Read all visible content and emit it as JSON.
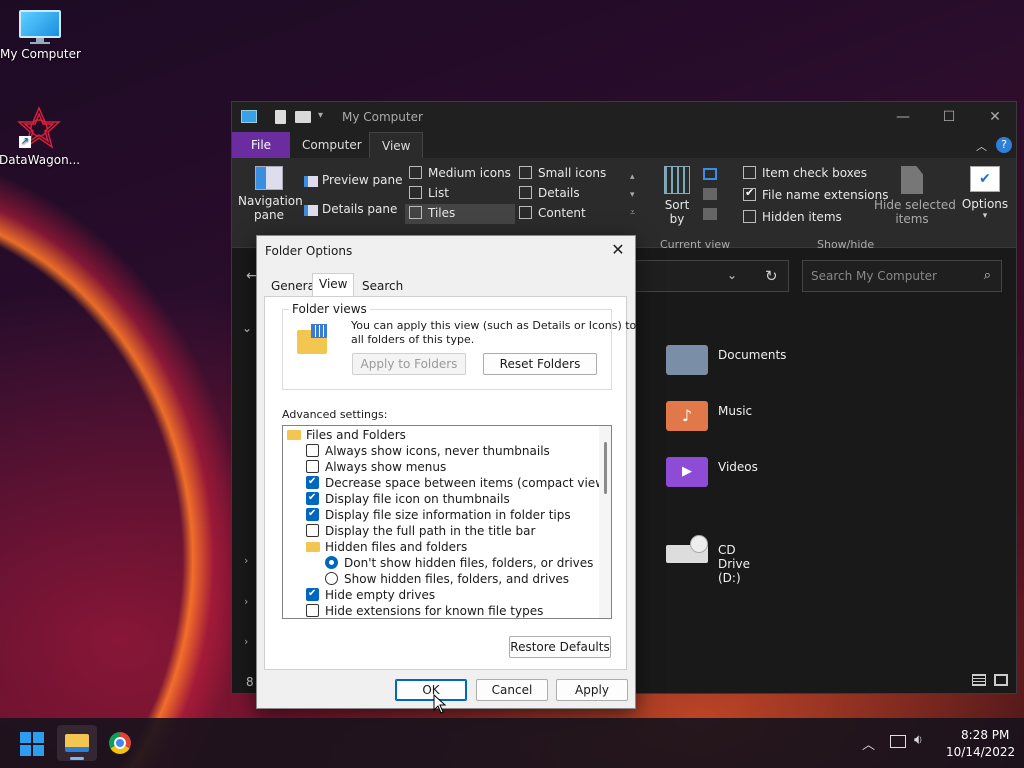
{
  "desktop": {
    "icons": [
      {
        "label": "My Computer"
      },
      {
        "label": "DataWagon..."
      }
    ]
  },
  "explorer": {
    "title": "My Computer",
    "tabs": {
      "file": "File",
      "computer": "Computer",
      "view": "View"
    },
    "ribbon": {
      "navigation_pane": "Navigation pane",
      "navigation_pane_l1": "Navigation",
      "navigation_pane_l2": "pane",
      "preview_pane": "Preview pane",
      "details_pane": "Details pane",
      "layouts": [
        "Medium icons",
        "Small icons",
        "List",
        "Details",
        "Tiles",
        "Content"
      ],
      "sort_l1": "Sort",
      "sort_l2": "by",
      "current_view": "Current view",
      "item_check_boxes": "Item check boxes",
      "file_name_extensions": "File name extensions",
      "hidden_items": "Hidden items",
      "show_hide": "Show/hide",
      "hide_selected_l1": "Hide selected",
      "hide_selected_l2": "items",
      "options": "Options"
    },
    "search_placeholder": "Search My Computer",
    "folders": [
      {
        "label": "Documents",
        "color": "#7b8ea8"
      },
      {
        "label": "Music",
        "color": "#e0784a"
      },
      {
        "label": "Videos",
        "color": "#8e4bd6"
      }
    ],
    "drive": {
      "label": "CD Drive (D:)"
    },
    "status_count": "8"
  },
  "dialog": {
    "title": "Folder Options",
    "tabs": [
      "General",
      "View",
      "Search"
    ],
    "folder_views": {
      "label": "Folder views",
      "text_l1": "You can apply this view (such as Details or Icons) to",
      "text_l2": "all folders of this type.",
      "apply_btn": "Apply to Folders",
      "reset_btn": "Reset Folders"
    },
    "advanced_label": "Advanced settings:",
    "tree": [
      {
        "type": "folder",
        "label": "Files and Folders",
        "level": 0
      },
      {
        "type": "check",
        "checked": false,
        "label": "Always show icons, never thumbnails",
        "level": 1
      },
      {
        "type": "check",
        "checked": false,
        "label": "Always show menus",
        "level": 1
      },
      {
        "type": "check",
        "checked": true,
        "label": "Decrease space between items (compact view)",
        "level": 1
      },
      {
        "type": "check",
        "checked": true,
        "label": "Display file icon on thumbnails",
        "level": 1
      },
      {
        "type": "check",
        "checked": true,
        "label": "Display file size information in folder tips",
        "level": 1
      },
      {
        "type": "check",
        "checked": false,
        "label": "Display the full path in the title bar",
        "level": 1
      },
      {
        "type": "folder",
        "label": "Hidden files and folders",
        "level": 1
      },
      {
        "type": "radio",
        "checked": true,
        "label": "Don't show hidden files, folders, or drives",
        "level": 2
      },
      {
        "type": "radio",
        "checked": false,
        "label": "Show hidden files, folders, and drives",
        "level": 2
      },
      {
        "type": "check",
        "checked": true,
        "label": "Hide empty drives",
        "level": 1
      },
      {
        "type": "check",
        "checked": false,
        "label": "Hide extensions for known file types",
        "level": 1
      }
    ],
    "restore_defaults": "Restore Defaults",
    "ok": "OK",
    "cancel": "Cancel",
    "apply": "Apply"
  },
  "taskbar": {
    "time": "8:28 PM",
    "date": "10/14/2022"
  },
  "colors": {
    "accent": "#0067c0",
    "file_tab": "#6a2c9e"
  }
}
